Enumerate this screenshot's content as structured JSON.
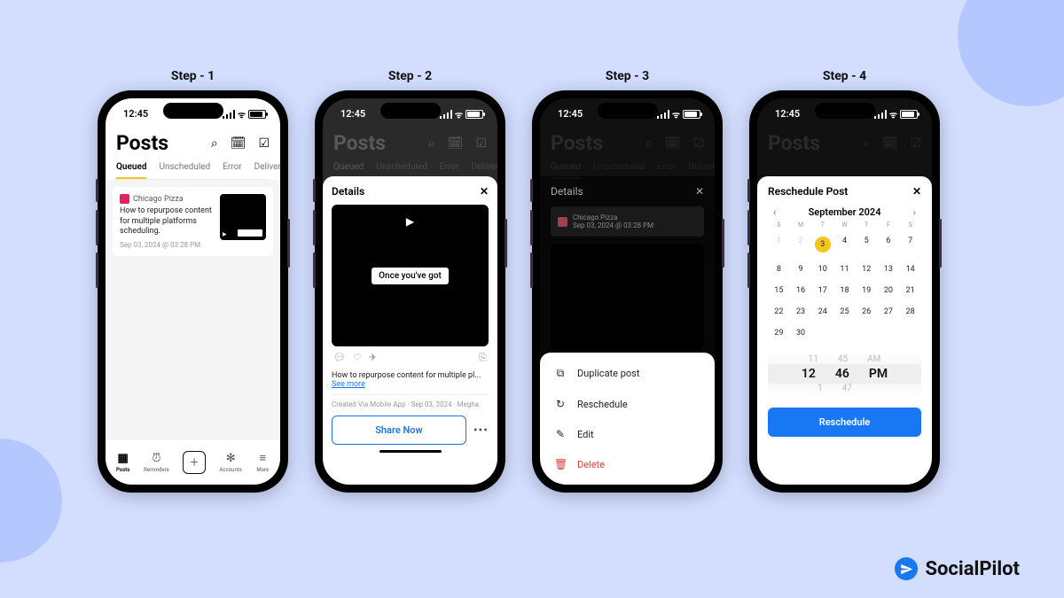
{
  "steps": [
    "Step - 1",
    "Step - 2",
    "Step - 3",
    "Step - 4"
  ],
  "status_time": "12:45",
  "brand": "SocialPilot",
  "step1": {
    "title": "Posts",
    "tabs": [
      "Queued",
      "Unscheduled",
      "Error",
      "Delivered"
    ],
    "active_tab": 0,
    "post": {
      "account": "Chicago Pizza",
      "text": "How to repurpose content for multiple platforms scheduling.",
      "ts": "Sep 03, 2024 @ 03:28 PM"
    },
    "nav": [
      "Posts",
      "Reminders",
      "",
      "Accounts",
      "More"
    ]
  },
  "step2": {
    "details_title": "Details",
    "caption": "Once you've got",
    "post_text": "How to repurpose content for multiple pl... ",
    "see_more": "See more",
    "meta": "Created Via Mobile App · Sep 03, 2024 · Megha",
    "share": "Share Now"
  },
  "step3": {
    "details_title": "Details",
    "account": "Chicago Pizza",
    "ts": "Sep 03, 2024 @ 03:28 PM",
    "menu": [
      {
        "icon": "⧉",
        "label": "Duplicate post"
      },
      {
        "icon": "↻",
        "label": "Reschedule"
      },
      {
        "icon": "✎",
        "label": "Edit"
      },
      {
        "icon": "🗑",
        "label": "Delete",
        "danger": true
      }
    ]
  },
  "step4": {
    "title": "Reschedule Post",
    "month": "September 2024",
    "dow": [
      "S",
      "M",
      "T",
      "W",
      "T",
      "F",
      "S"
    ],
    "days": [
      {
        "n": 1,
        "mute": true
      },
      {
        "n": 2,
        "mute": true
      },
      {
        "n": 3,
        "sel": true
      },
      {
        "n": 4
      },
      {
        "n": 5
      },
      {
        "n": 6
      },
      {
        "n": 7
      },
      {
        "n": 8
      },
      {
        "n": 9
      },
      {
        "n": 10
      },
      {
        "n": 11
      },
      {
        "n": 12
      },
      {
        "n": 13
      },
      {
        "n": 14
      },
      {
        "n": 15
      },
      {
        "n": 16
      },
      {
        "n": 17
      },
      {
        "n": 18
      },
      {
        "n": 19
      },
      {
        "n": 20
      },
      {
        "n": 21
      },
      {
        "n": 22
      },
      {
        "n": 23
      },
      {
        "n": 24
      },
      {
        "n": 25
      },
      {
        "n": 26
      },
      {
        "n": 27
      },
      {
        "n": 28
      },
      {
        "n": 29
      },
      {
        "n": 30
      }
    ],
    "picker": {
      "above": [
        "11",
        "45",
        "AM"
      ],
      "mid": [
        "12",
        "46",
        "PM"
      ],
      "below": [
        "1",
        "47",
        ""
      ]
    },
    "button": "Reschedule"
  }
}
